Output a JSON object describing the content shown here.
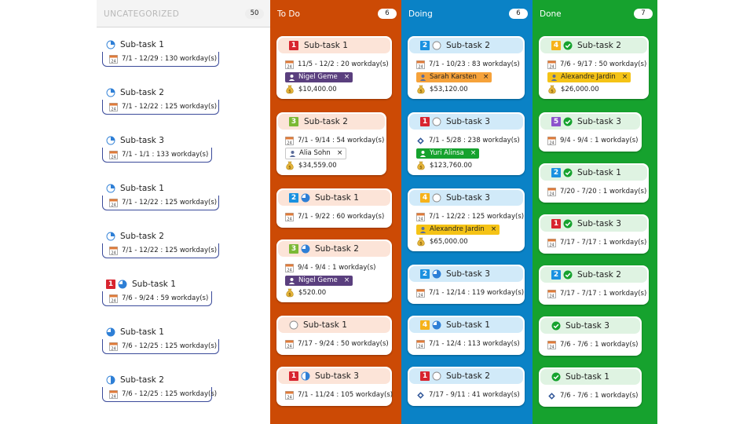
{
  "columns": {
    "uncategorized": {
      "title": "UNCATEGORIZED",
      "count": "50"
    },
    "todo": {
      "title": "To Do",
      "count": "6"
    },
    "doing": {
      "title": "Doing",
      "count": "6"
    },
    "done": {
      "title": "Done",
      "count": "7"
    }
  },
  "uncategorized": [
    {
      "title": "Sub-task 1",
      "dates": "7/1 - 12/29 : 130 workday(s)",
      "status": "pie-25",
      "priority": ""
    },
    {
      "title": "Sub-task 2",
      "dates": "7/1 - 12/22 : 125 workday(s)",
      "status": "pie-25",
      "priority": ""
    },
    {
      "title": "Sub-task 3",
      "dates": "7/1 - 1/1 : 133 workday(s)",
      "status": "pie-25",
      "priority": ""
    },
    {
      "title": "Sub-task 1",
      "dates": "7/1 - 12/22 : 125 workday(s)",
      "status": "pie-25",
      "priority": ""
    },
    {
      "title": "Sub-task 2",
      "dates": "7/1 - 12/22 : 125 workday(s)",
      "status": "pie-25",
      "priority": ""
    },
    {
      "title": "Sub-task 1",
      "dates": "7/6 - 9/24 : 59 workday(s)",
      "status": "pie-75",
      "priority": "1"
    },
    {
      "title": "Sub-task 1",
      "dates": "7/6 - 12/25 : 125 workday(s)",
      "status": "pie-75",
      "priority": ""
    },
    {
      "title": "Sub-task 2",
      "dates": "7/6 - 12/25 : 125 workday(s)",
      "status": "pie-50",
      "priority": ""
    }
  ],
  "todo": [
    {
      "title": "Sub-task 1",
      "priority": "1",
      "status": "",
      "dates": "11/5 - 12/2 : 20 workday(s)",
      "assignee": "Nigel Geme",
      "assignee_color": "#5a3f7e",
      "amount": "$10,400.00"
    },
    {
      "title": "Sub-task 2",
      "priority": "3",
      "status": "",
      "dates": "7/1 - 9/14 : 54 workday(s)",
      "assignee": "Alia Sohn",
      "assignee_color": "#ffffff",
      "amount": "$34,559.00"
    },
    {
      "title": "Sub-task 1",
      "priority": "2",
      "status": "pie-75",
      "dates": "7/1 - 9/22 : 60 workday(s)",
      "assignee": "",
      "assignee_color": "",
      "amount": ""
    },
    {
      "title": "Sub-task 2",
      "priority": "3",
      "status": "pie-75",
      "dates": "9/4 - 9/4 : 1 workday(s)",
      "assignee": "Nigel Geme",
      "assignee_color": "#5a3f7e",
      "amount": "$520.00"
    },
    {
      "title": "Sub-task 1",
      "priority": "",
      "status": "empty",
      "dates": "7/17 - 9/24 : 50 workday(s)",
      "assignee": "",
      "assignee_color": "",
      "amount": ""
    },
    {
      "title": "Sub-task 3",
      "priority": "1",
      "status": "pie-50",
      "dates": "7/1 - 11/24 : 105 workday(s)",
      "assignee": "",
      "assignee_color": "",
      "amount": ""
    }
  ],
  "doing": [
    {
      "title": "Sub-task 2",
      "priority": "2",
      "status": "empty",
      "dates": "7/1 - 10/23 : 83 workday(s)",
      "date_icon": "calendar",
      "assignee": "Sarah Karsten",
      "assignee_color": "#f6a23a",
      "amount": "$53,120.00"
    },
    {
      "title": "Sub-task 3",
      "priority": "1",
      "status": "empty",
      "dates": "7/1 - 5/28 : 238 workday(s)",
      "date_icon": "diamond",
      "assignee": "Yuri Alinsa",
      "assignee_color": "#16a22e",
      "amount": "$123,760.00"
    },
    {
      "title": "Sub-task 3",
      "priority": "4",
      "status": "empty",
      "dates": "7/1 - 12/22 : 125 workday(s)",
      "date_icon": "calendar",
      "assignee": "Alexandre Jardin",
      "assignee_color": "#f5c316",
      "amount": "$65,000.00"
    },
    {
      "title": "Sub-task 3",
      "priority": "2",
      "status": "pie-75",
      "dates": "7/1 - 12/14 : 119 workday(s)",
      "date_icon": "calendar",
      "assignee": "",
      "assignee_color": "",
      "amount": ""
    },
    {
      "title": "Sub-task 1",
      "priority": "4",
      "status": "pie-75",
      "dates": "7/1 - 12/4 : 113 workday(s)",
      "date_icon": "calendar",
      "assignee": "",
      "assignee_color": "",
      "amount": ""
    },
    {
      "title": "Sub-task 2",
      "priority": "1",
      "status": "empty",
      "dates": "7/17 - 9/11 : 41 workday(s)",
      "date_icon": "diamond",
      "assignee": "",
      "assignee_color": "",
      "amount": ""
    }
  ],
  "done": [
    {
      "title": "Sub-task 2",
      "priority": "4",
      "status": "check",
      "dates": "7/6 - 9/17 : 50 workday(s)",
      "date_icon": "calendar",
      "assignee": "Alexandre Jardin",
      "assignee_color": "#f5c316",
      "amount": "$26,000.00"
    },
    {
      "title": "Sub-task 3",
      "priority": "5",
      "status": "check",
      "dates": "9/4 - 9/4 : 1 workday(s)",
      "date_icon": "calendar",
      "assignee": "",
      "assignee_color": "",
      "amount": ""
    },
    {
      "title": "Sub-task 1",
      "priority": "2",
      "status": "check",
      "dates": "7/20 - 7/20 : 1 workday(s)",
      "date_icon": "calendar",
      "assignee": "",
      "assignee_color": "",
      "amount": ""
    },
    {
      "title": "Sub-task 3",
      "priority": "1",
      "status": "check",
      "dates": "7/17 - 7/17 : 1 workday(s)",
      "date_icon": "calendar",
      "assignee": "",
      "assignee_color": "",
      "amount": ""
    },
    {
      "title": "Sub-task 2",
      "priority": "2",
      "status": "check",
      "dates": "7/17 - 7/17 : 1 workday(s)",
      "date_icon": "calendar",
      "assignee": "",
      "assignee_color": "",
      "amount": ""
    },
    {
      "title": "Sub-task 3",
      "priority": "",
      "status": "check",
      "dates": "7/6 - 7/6 : 1 workday(s)",
      "date_icon": "calendar",
      "assignee": "",
      "assignee_color": "",
      "amount": ""
    },
    {
      "title": "Sub-task 1",
      "priority": "",
      "status": "check",
      "dates": "7/6 - 7/6 : 1 workday(s)",
      "date_icon": "diamond",
      "assignee": "",
      "assignee_color": "",
      "amount": ""
    }
  ],
  "icons": {
    "calendar_day": "24",
    "calendar": "calendar-icon",
    "diamond": "milestone-icon",
    "person": "person-icon",
    "money": "money-bag-icon",
    "remove": "×"
  },
  "colors": {
    "todo": "#cc4a05",
    "doing": "#0a82c6",
    "done": "#16a22e",
    "uncat_border": "#3a4a9a"
  }
}
